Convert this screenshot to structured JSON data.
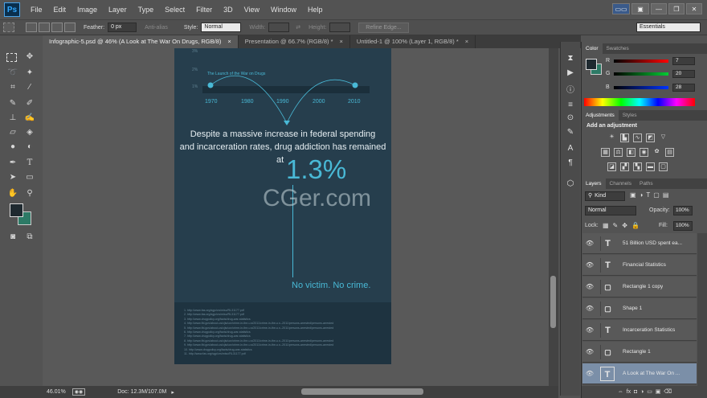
{
  "app": {
    "logo": "Ps"
  },
  "menu": [
    "File",
    "Edit",
    "Image",
    "Layer",
    "Type",
    "Select",
    "Filter",
    "3D",
    "View",
    "Window",
    "Help"
  ],
  "window_controls": {
    "minimize": "—",
    "restore": "❐",
    "close": "✕"
  },
  "options": {
    "feather_label": "Feather:",
    "feather_value": "0 px",
    "antialias_label": "Anti-alias",
    "style_label": "Style:",
    "style_value": "Normal",
    "width_label": "Width:",
    "height_label": "Height:",
    "refine_edge": "Refine Edge...",
    "workspace": "Essentials"
  },
  "tabs": [
    {
      "label": "Infographic-5.psd @ 46% (A Look at The War On Drugs, RGB/8)",
      "close": "×"
    },
    {
      "label": "Presentation @ 66.7% (RGB/8) *",
      "close": "×"
    },
    {
      "label": "Untitled-1 @ 100% (Layer 1, RGB/8) *",
      "close": "×"
    }
  ],
  "document": {
    "percent_ticks": [
      "3%",
      "2%",
      "1%"
    ],
    "timeline_caption": "The Launch of the War on Drugs",
    "years": [
      "1970",
      "1980",
      "1990",
      "2000",
      "2010"
    ],
    "body_text_1": "Despite a massive increase in federal spending",
    "body_text_2": "and incarceration rates, drug addiction has remained",
    "body_text_3": "at",
    "big_stat": "1.3%",
    "slogan": "No victim.  No crime.",
    "watermark": "CGer.com",
    "footnotes": [
      "1. http://www.fas.org/sgp/crs/misc/RL31177.pdf",
      "2. http://www.fas.org/sgp/crs/misc/RL31177.pdf",
      "3. http://www.drugpolicy.org/facts/drug-war-statistics",
      "4. http://www.fbi.gov/about-us/cjis/ucr/crime-in-the-u.s/2011/crime-in-the-u.s.-2011/persons-arrested/persons-arrested",
      "5. http://www.fbi.gov/about-us/cjis/ucr/crime-in-the-u.s/2011/crime-in-the-u.s.-2011/persons-arrested/persons-arrested",
      "6. http://www.drugpolicy.org/facts/drug-war-statistics",
      "7. http://www.drugpolicy.org/facts/drug-war-statistics",
      "8. http://www.fbi.gov/about-us/cjis/ucr/crime-in-the-u.s/2011/crime-in-the-u.s.-2011/persons-arrested/persons-arrested",
      "9. http://www.fbi.gov/about-us/cjis/ucr/crime-in-the-u.s/2011/crime-in-the-u.s.-2011/persons-arrested/persons-arrested",
      "10. http://www.drugpolicy.org/facts/drug-war-statistics",
      "11. http://www.fas.org/sgp/crs/misc/RL31177.pdf"
    ]
  },
  "status": {
    "zoom": "46.01%",
    "doc": "Doc: 12.3M/107.0M"
  },
  "color_panel": {
    "tabs": [
      "Color",
      "Swatches"
    ],
    "channels": [
      {
        "label": "R",
        "value": "7"
      },
      {
        "label": "G",
        "value": "20"
      },
      {
        "label": "B",
        "value": "28"
      }
    ]
  },
  "adjustments_panel": {
    "tabs": [
      "Adjustments",
      "Styles"
    ],
    "heading": "Add an adjustment"
  },
  "layers_panel": {
    "tabs": [
      "Layers",
      "Channels",
      "Paths"
    ],
    "filter": "Kind",
    "blend_mode": "Normal",
    "opacity_label": "Opacity:",
    "opacity_value": "100%",
    "lock_label": "Lock:",
    "fill_label": "Fill:",
    "fill_value": "100%",
    "layers": [
      {
        "name": "51 Billion USD spent ea...",
        "kind": "T"
      },
      {
        "name": "Financial Statistics",
        "kind": "T"
      },
      {
        "name": "Rectangle 1 copy",
        "kind": "▢"
      },
      {
        "name": "Shape 1",
        "kind": "▢"
      },
      {
        "name": "Incarceration Statistics",
        "kind": "T"
      },
      {
        "name": "Rectangle 1",
        "kind": "▢"
      },
      {
        "name": "A Look at The War On ...",
        "kind": "T"
      }
    ],
    "footer_icons": "⇔  fx  ◘  ◑  ▭  ▣  ⌫"
  },
  "colors": {
    "doc_bg": "#263e4d",
    "accent": "#49b9d6",
    "fg_swatch": "#1f2a30",
    "bg_swatch": "#2d7a66"
  }
}
